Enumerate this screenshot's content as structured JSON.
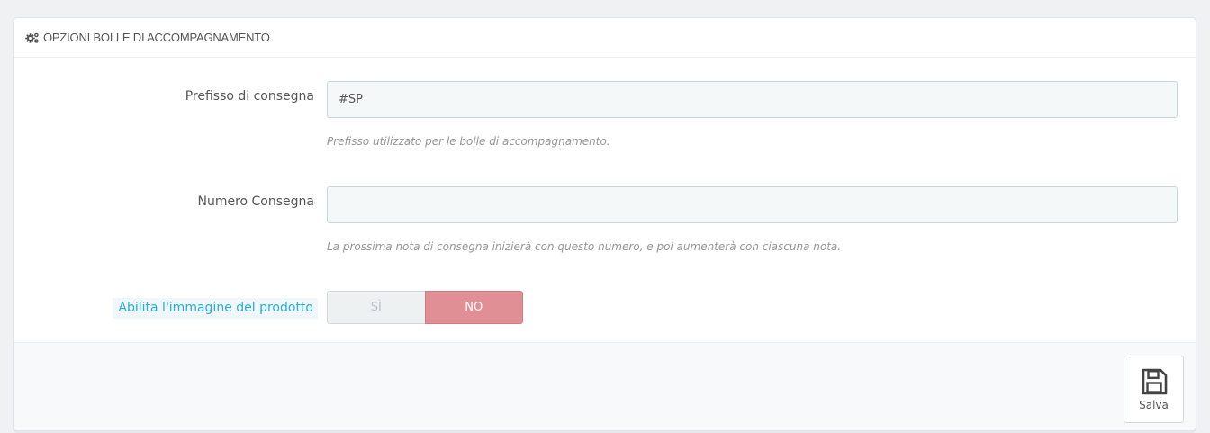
{
  "panel": {
    "heading_icon": "cogs-icon",
    "title": "OPZIONI BOLLE DI ACCOMPAGNAMENTO"
  },
  "fields": {
    "prefix": {
      "label": "Prefisso di consegna",
      "value": "#SP",
      "help": "Prefisso utilizzato per le bolle di accompagnamento."
    },
    "number": {
      "label": "Numero Consegna",
      "value": "",
      "help": "La prossima nota di consegna inizierà con questo numero, e poi aumenterà con ciascuna nota."
    },
    "product_image": {
      "label": "Abilita l'immagine del prodotto",
      "yes_label": "SÌ",
      "no_label": "NO",
      "selected": "NO"
    }
  },
  "footer": {
    "save_label": "Salva",
    "save_icon": "floppy-disk-icon"
  },
  "colors": {
    "accent_blue": "#2eacce",
    "switch_no": "#e08f95",
    "input_bg": "#f5f8f9"
  }
}
